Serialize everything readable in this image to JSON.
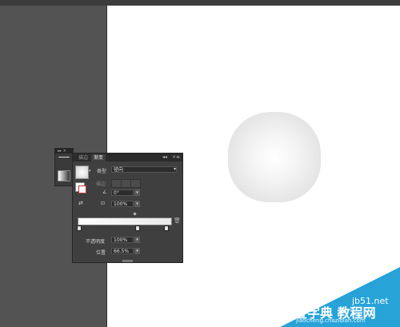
{
  "panel": {
    "tabs": [
      "描边",
      "渐变"
    ],
    "active_tab": "渐变",
    "collapse_glyph": "◂◂",
    "close_glyph": "×",
    "menu_glyph": "≡",
    "type_label": "类型",
    "type_value": "径向",
    "stroke_label": "描边",
    "angle_value": "0°",
    "aspect_value": "100%",
    "opacity_label": "不透明度",
    "opacity_value": "100%",
    "location_label": "位置",
    "location_value": "66.5%"
  },
  "watermark": {
    "site": "jb51.net",
    "name": "查字典 教程网",
    "url": "jiaocheng.chazidian.com"
  },
  "icons": [
    "panel-menu-icon",
    "gradient-thumbnail-icon",
    "fill-stroke-icon",
    "reverse-gradient-icon",
    "angle-icon",
    "aspect-ratio-icon",
    "trash-icon",
    "gradient-stop-icon",
    "midpoint-diamond-icon"
  ]
}
